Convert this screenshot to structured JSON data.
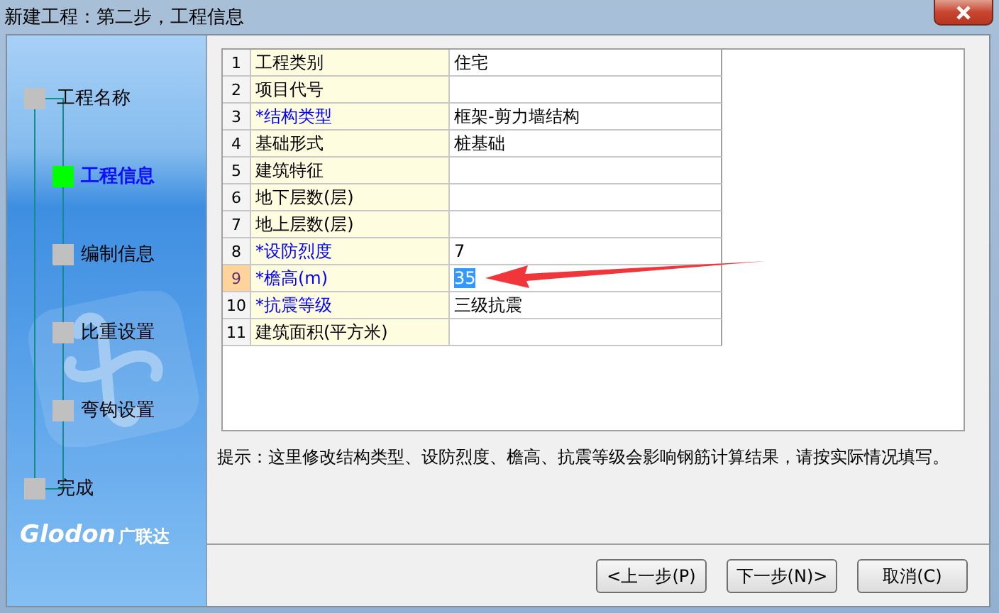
{
  "window": {
    "title": "新建工程：第二步，工程信息"
  },
  "steps": [
    {
      "label": "工程名称",
      "kind": "end",
      "selected": false
    },
    {
      "label": "工程信息",
      "kind": "step",
      "selected": true
    },
    {
      "label": "编制信息",
      "kind": "step",
      "selected": false
    },
    {
      "label": "比重设置",
      "kind": "step",
      "selected": false
    },
    {
      "label": "弯钩设置",
      "kind": "step",
      "selected": false
    },
    {
      "label": "完成",
      "kind": "end",
      "selected": false
    }
  ],
  "brand": {
    "latin": "Glodon",
    "chinese": "广联达"
  },
  "table": {
    "rows": [
      {
        "number": "1",
        "name": "工程类别",
        "value": "住宅",
        "required": false,
        "selected": false
      },
      {
        "number": "2",
        "name": "项目代号",
        "value": "",
        "required": false,
        "selected": false
      },
      {
        "number": "3",
        "name": "*结构类型",
        "value": "框架-剪力墙结构",
        "required": true,
        "selected": false
      },
      {
        "number": "4",
        "name": "基础形式",
        "value": "桩基础",
        "required": false,
        "selected": false
      },
      {
        "number": "5",
        "name": "建筑特征",
        "value": "",
        "required": false,
        "selected": false
      },
      {
        "number": "6",
        "name": "地下层数(层)",
        "value": "",
        "required": false,
        "selected": false
      },
      {
        "number": "7",
        "name": "地上层数(层)",
        "value": "",
        "required": false,
        "selected": false
      },
      {
        "number": "8",
        "name": "*设防烈度",
        "value": "7",
        "required": true,
        "selected": false
      },
      {
        "number": "9",
        "name": "*檐高(m)",
        "value": "35",
        "required": true,
        "selected": true
      },
      {
        "number": "10",
        "name": "*抗震等级",
        "value": "三级抗震",
        "required": true,
        "selected": false
      },
      {
        "number": "11",
        "name": "建筑面积(平方米)",
        "value": "",
        "required": false,
        "selected": false
      }
    ]
  },
  "hint": "提示：这里修改结构类型、设防烈度、檐高、抗震等级会影响钢筋计算结果，请按实际情况填写。",
  "buttons": [
    "<上一步(P)",
    "下一步(N)>",
    "取消(C)"
  ]
}
